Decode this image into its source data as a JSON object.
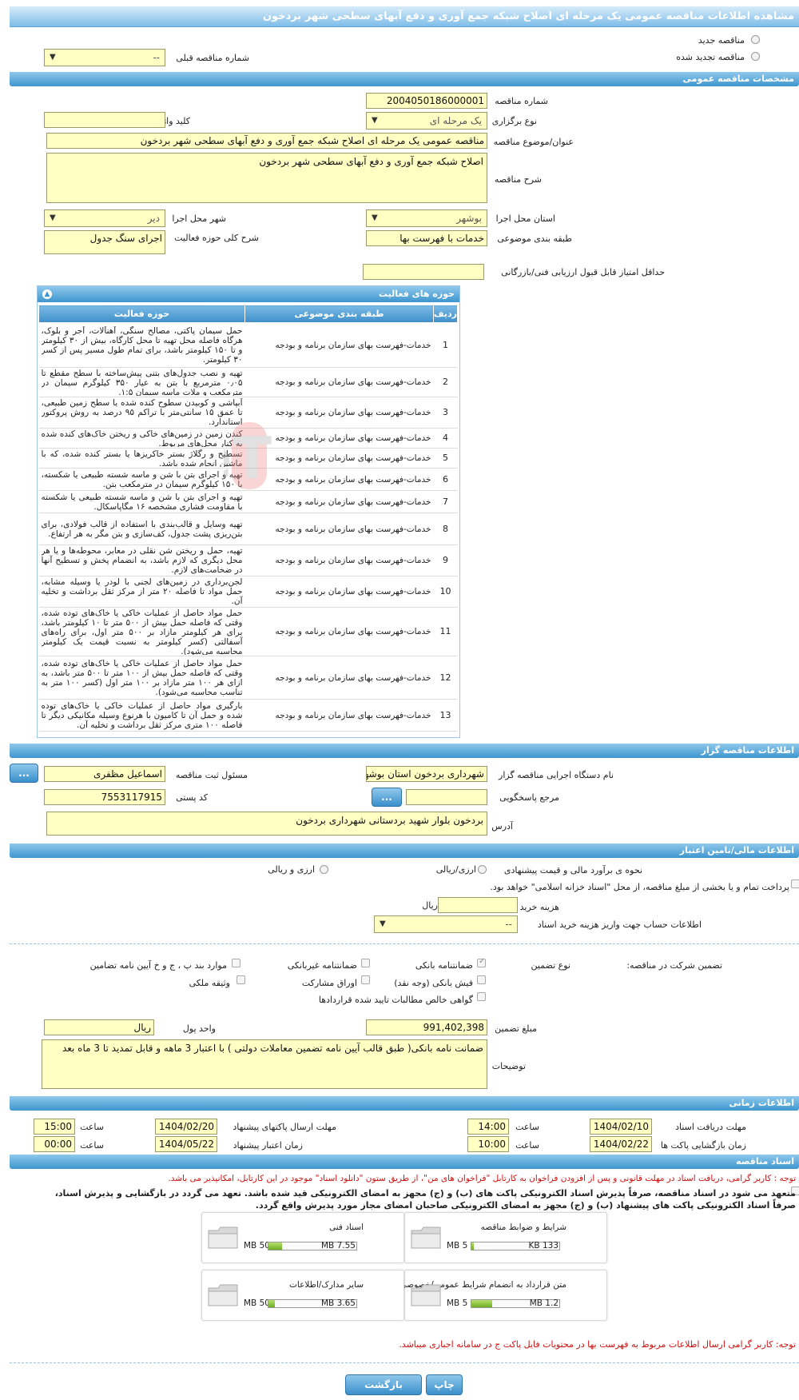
{
  "page": {
    "title": "مشاهده اطلاعات مناقصه عمومی یک مرحله ای اصلاح شبکه جمع آوری و دفع آبهای سطحی شهر بردخون"
  },
  "tender_type": {
    "new_label": "مناقصه جدید",
    "renewed_label": "مناقصه تجدید شده",
    "prev_number_label": "شماره مناقصه قبلی",
    "prev_number_value": "--"
  },
  "general": {
    "section_title": "مشخصات مناقصه عمومی",
    "number_label": "شماره مناقصه",
    "number_value": "2004050186000001",
    "type_label": "نوع برگزاری",
    "type_value": "یک مرحله ای",
    "keyword_label": "کلید واژه",
    "keyword_value": "",
    "subject_label": "عنوان/موضوع مناقصه",
    "subject_value": "مناقصه عمومی یک مرحله ای اصلاح شبکه جمع آوری و دفع آبهای سطحی شهر بردخون",
    "desc_label": "شرح مناقصه",
    "desc_value": "اصلاح شبکه جمع آوری و دفع آبهای سطحی شهر بردخون",
    "province_label": "استان محل اجرا",
    "province_value": "بوشهر",
    "city_label": "شهر محل اجرا",
    "city_value": "دیر",
    "category_label": "طبقه بندی موضوعی",
    "category_value": "خدمات با فهرست بها",
    "scope_label": "شرح کلی حوزه فعالیت",
    "scope_value": "اجرای سنگ جدول",
    "min_score_label": "حداقل امتیاز قابل قبول ارزیابی فنی/بازرگانی",
    "min_score_value": ""
  },
  "activities": {
    "panel_title": "حوزه های فعالیت",
    "col_row": "ردیف",
    "col_category": "طبقه بندی موضوعی",
    "col_activity": "حوزه فعالیت",
    "rows": [
      {
        "n": "1",
        "cat": "خدمات-فهرست بهای سازمان برنامه و بودجه",
        "desc": "حمل سیمان پاکتی، مصالح سنگی، آهنآلات، آجر و بلوک، هرگاه فاصله محل تهیه تا محل کارگاه، بیش از ۳۰ کیلومتر و تا ۱۵۰ کیلومتر باشد، برای تمام طول مسیر پس از کسر ۳۰ کیلومتر."
      },
      {
        "n": "2",
        "cat": "خدمات-فهرست بهای سازمان برنامه و بودجه",
        "desc": "تهیه و نصب جدول‌های بتنی پیش‌ساخته با سطح مقطع تا ۰٫۰۵ مترمربع با بتن به عیار ۳۵۰ کیلوگرم سیمان در مترمکعب و ملات ماسه سیمان ۱:۵."
      },
      {
        "n": "3",
        "cat": "خدمات-فهرست بهای سازمان برنامه و بودجه",
        "desc": "آبپاشی و کوبیدن سطوح کنده شده یا سطح زمین طبیعی، تا عمق ۱۵ سانتی‌متر با تراکم ۹۵ درصد به روش پروکتور استاندارد."
      },
      {
        "n": "4",
        "cat": "خدمات-فهرست بهای سازمان برنامه و بودجه",
        "desc": "کندن زمین در زمین‌های خاکی و ریختن خاک‌های کنده شده به کنار محل‌های مربوط."
      },
      {
        "n": "5",
        "cat": "خدمات-فهرست بهای سازمان برنامه و بودجه",
        "desc": "تسطیح و رگلاژ بستر خاکریزها یا بستر کنده شده، که با ماشین انجام شده باشد."
      },
      {
        "n": "6",
        "cat": "خدمات-فهرست بهای سازمان برنامه و بودجه",
        "desc": "تهیه و اجرای بتن با شن و ماسه شسته طبیعی یا شکسته، با ۱۵۰ کیلوگرم سیمان در مترمکعب بتن."
      },
      {
        "n": "7",
        "cat": "خدمات-فهرست بهای سازمان برنامه و بودجه",
        "desc": "تهیه و اجرای بتن با شن و ماسه شسته طبیعی یا شکسته با مقاومت فشاری مشخصه ۱۶ مگاپاسکال."
      },
      {
        "n": "8",
        "cat": "خدمات-فهرست بهای سازمان برنامه و بودجه",
        "desc": "تهیه وسایل و قالب‌بندی با استفاده از قالب فولادی، برای بتن‌ریزی پشت جدول، کف‌سازی و بتن مگر به هر ارتفاع."
      },
      {
        "n": "9",
        "cat": "خدمات-فهرست بهای سازمان برنامه و بودجه",
        "desc": "تهیه، حمل و ریختن شن نقلی در معابر، محوطه‌ها و یا هر محل دیگری که لازم باشد، به انضمام پخش و تسطیح آنها در ضخامت‌های لازم."
      },
      {
        "n": "10",
        "cat": "خدمات-فهرست بهای سازمان برنامه و بودجه",
        "desc": "لجن‌برداری در زمین‌های لجنی با لودر یا وسیله مشابه، حمل مواد تا فاصله ۲۰ متر از مرکز ثقل برداشت و تخلیه آن."
      },
      {
        "n": "11",
        "cat": "خدمات-فهرست بهای سازمان برنامه و بودجه",
        "desc": "حمل مواد حاصل از عملیات خاکی یا خاک‌های توده شده، وقتی که فاصله حمل بیش از ۵۰۰ متر تا ۱۰ کیلومتر باشد، برای هر کیلومتر مازاد بر ۵۰۰ متر اول، برای راه‌های آسفالتی (کسر کیلومتر به نسبت قیمت یک کیلومتر محاسبه می‌شود)."
      },
      {
        "n": "12",
        "cat": "خدمات-فهرست بهای سازمان برنامه و بودجه",
        "desc": "حمل مواد حاصل از عملیات خاکی یا خاک‌های توده شده، وقتی که فاصله حمل بیش از ۱۰۰ متر تا ۵۰۰ متر باشد، به ازای هر ۱۰۰ متر مازاد بر ۱۰۰ متر اول (کسر ۱۰۰ متر به تناسب محاسبه می‌شود)."
      },
      {
        "n": "13",
        "cat": "خدمات-فهرست بهای سازمان برنامه و بودجه",
        "desc": "بارگیری مواد حاصل از عملیات خاکی یا خاک‌های توده شده و حمل آن تا کامیون با هرنوع وسیله مکانیکی دیگر تا فاصله ۱۰۰ متری مرکز ثقل برداشت و تخلیه آن."
      }
    ]
  },
  "organizer": {
    "section_title": "اطلاعات مناقصه گزار",
    "org_label": "نام دستگاه اجرایی مناقصه گزار",
    "org_value": "شهرداری بردخون استان بوشهر",
    "responsible_label": "مسئول ثبت مناقصه",
    "responsible_value": "اسماعیل مظفری",
    "more_btn": "...",
    "ref_label": "مرجع پاسخگویی",
    "ref_value": "",
    "postal_label": "کد پستی",
    "postal_value": "7553117915",
    "address_label": "آدرس",
    "address_value": "بردخون بلوار شهید بردستانی شهرداری بردخون"
  },
  "financial": {
    "section_title": "اطلاعات مالی/تامین اعتبار",
    "estimate_label": "نحوه ی برآورد مالی و قیمت پیشنهادی",
    "rial_label": "ارزی/ریالی",
    "fx_rial_label": "ارزی و ریالی",
    "treasury_text": "پرداخت تمام و یا بخشی از مبلغ مناقصه، از محل \"اسناد خزانه اسلامی\" خواهد بود.",
    "doc_fee_label": "هزینه خرید اسناد",
    "doc_fee_value": "",
    "doc_fee_unit": "ریال",
    "account_label": "اطلاعات حساب جهت واریز هزینه خرید اسناد",
    "account_value": "--"
  },
  "guarantee": {
    "type_label": "نوع تضمین",
    "participation_label": "تضمین شرکت در مناقصه:",
    "bank_guarantee": "ضمانتنامه بانکی",
    "nonbank_guarantee": "ضمانتنامه غیربانکی",
    "clauses": "موارد بند پ ، ج و خ آیین نامه تضامین",
    "bank_check": "فیش بانکی (وجه نقد)",
    "bonds": "اوراق مشارکت",
    "property": "وثیقه ملکی",
    "receivables": "گواهی خالص مطالبات تایید شده قراردادها",
    "amount_label": "مبلغ تضمین",
    "amount_value": "991,402,398",
    "currency_label": "واحد پول",
    "currency_value": "ریال",
    "notes_label": "توضیحات",
    "notes_value": "ضمانت نامه بانکی( طبق قالب آیین نامه تضمین معاملات دولتی ) با اعتبار 3 ماهه  و قابل تمدید تا 3 ماه بعد"
  },
  "timing": {
    "section_title": "اطلاعات زمانی",
    "doc_receive_label": "مهلت دریافت اسناد",
    "doc_receive_date": "1404/02/10",
    "doc_receive_time": "14:00",
    "send_label": "مهلت ارسال پاکتهای پیشنهاد",
    "send_date": "1404/02/20",
    "send_time": "15:00",
    "open_label": "زمان بازگشایی پاکت ها",
    "open_date": "1404/02/22",
    "open_time": "10:00",
    "validity_label": "زمان اعتبار پیشنهاد",
    "validity_date": "1404/05/22",
    "validity_time": "00:00",
    "time_label": "ساعت"
  },
  "documents": {
    "section_title": "اسناد مناقصه",
    "note1": "توجه : کاربر گرامی، دریافت اسناد در مهلت قانونی و پس از افزودن فراخوان به کارتابل \"فراخوان های من\"، از طریق ستون \"دانلود اسناد\" موجود در این کارتابل، امکانپذیر می باشد.",
    "commit1": "متعهد می شود در اسناد مناقصه، صرفاً پذیرش اسناد الکترونیکی پاکت های (ب) و (ج) مجهز به امضای الکترونیکی قید شده باشد. تعهد می گردد در بازگشایی و پذیرش اسناد،",
    "commit2": "صرفاً اسناد الکترونیکی پاکت های پیشنهاد (ب) و (ج) مجهز به امضای الکترونیکی صاحبان امضای مجاز مورد پذیرش واقع گردد.",
    "tiles": [
      {
        "name": "شرایط و ضوابط مناقصه",
        "max": "5 MB",
        "cur": "133 KB",
        "fill": 0.03
      },
      {
        "name": "اسناد فنی",
        "max": "50 MB",
        "cur": "7.55 MB",
        "fill": 0.15
      },
      {
        "name": "متن قرارداد به انضمام شرایط عمومی/خصوصی",
        "max": "5 MB",
        "cur": "1.2 MB",
        "fill": 0.24
      },
      {
        "name": "سایر مدارک/اطلاعات",
        "max": "50 MB",
        "cur": "3.65 MB",
        "fill": 0.07
      }
    ],
    "note2": "توجه: کاربر گرامی ارسال اطلاعات مربوط به فهرست بها در محتویات فایل پاکت ج در سامانه اجباری میباشد."
  },
  "footer": {
    "print_label": "چاپ",
    "back_label": "بازگشت"
  },
  "watermark": "AriaTender.neT",
  "colors": {
    "accent": "#3e96cf",
    "field_bg": "#ffffc4",
    "warning": "#d01010"
  }
}
